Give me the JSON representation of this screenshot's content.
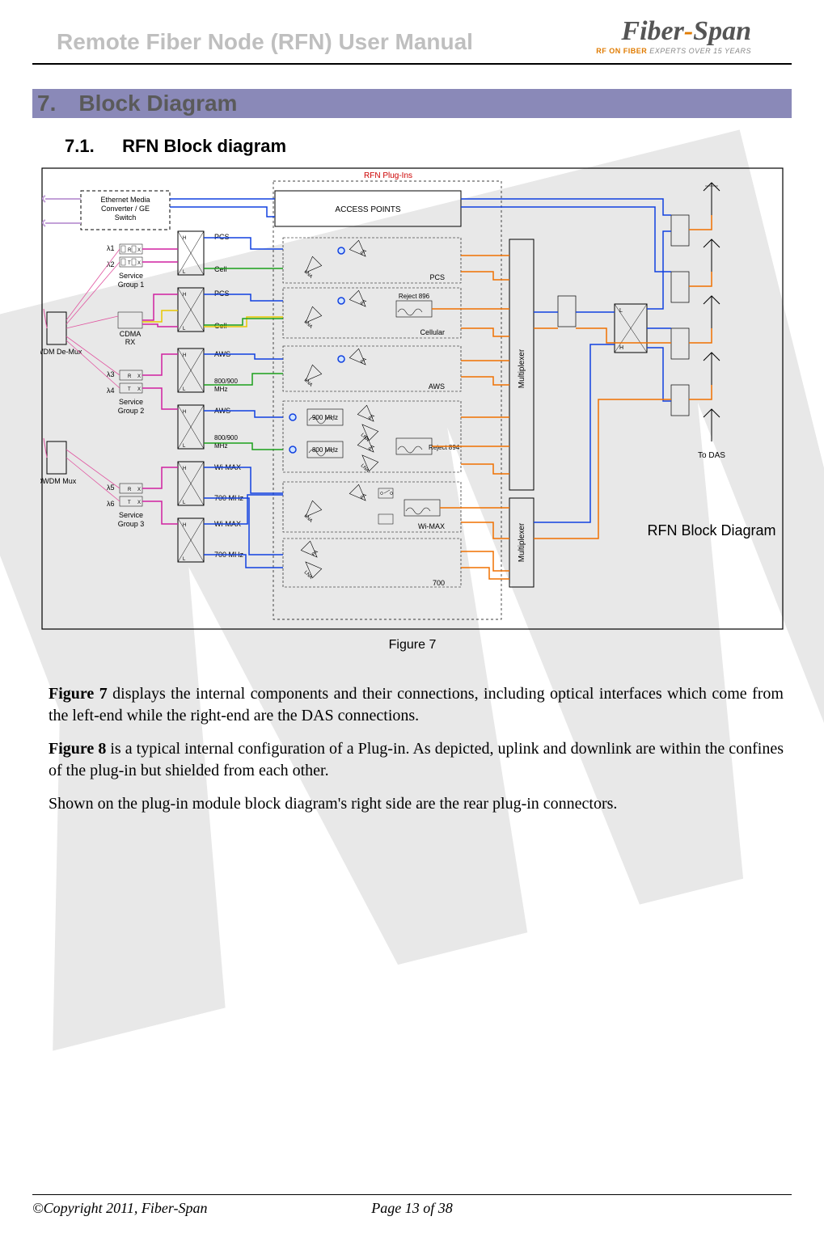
{
  "header": {
    "title": "Remote Fiber Node (RFN) User Manual",
    "logo_main": "Fiber-Span",
    "logo_sub1": "RF ON FIBER",
    "logo_sub2": " EXPERTS OVER 15 YEARS"
  },
  "section": {
    "num": "7.",
    "title": "Block Diagram"
  },
  "subsection": {
    "num": "7.1.",
    "title": "RFN Block diagram"
  },
  "diagram": {
    "top_label": "RFN Plug-Ins",
    "access_points": "ACCESS POINTS",
    "ethernet": "Ethernet Media Converter / GE Switch",
    "dwdm_demux": "DWDM De-Mux",
    "dwdm_mux": "DWDM Mux",
    "sg1": "Service Group 1",
    "sg2": "Service Group 2",
    "sg3": "Service Group 3",
    "cdma_rx": "CDMA RX",
    "lambda1": "λ1",
    "lambda2": "λ2",
    "lambda3": "λ3",
    "lambda4": "λ4",
    "lambda5": "λ5",
    "lambda6": "λ6",
    "label_pcs": "PCS",
    "label_cell": "Cell",
    "label_aws": "AWS",
    "label_800_900": "800/900 MHz",
    "label_wimax": "Wi-MAX",
    "label_700mhz": "700 MHz",
    "label_reject896": "Reject 896",
    "label_cellular": "Cellular",
    "label_900mhz": "900 MHz",
    "label_800mhz": "800 MHz",
    "label_reject894": "Reject 894",
    "label_wimax2": "Wi-MAX",
    "label_700": "700",
    "label_pcs2": "PCS",
    "label_aws2": "AWS",
    "multiplexer": "Multiplexer",
    "to_das": "To DAS",
    "pa": "PA",
    "lna": "LNA",
    "rfn_title": "RFN Block Diagram",
    "caption": "Figure 7",
    "r": "R",
    "t": "T",
    "x": "X",
    "h": "H",
    "l": "L"
  },
  "paragraphs": {
    "p1_a": "Figure 7",
    "p1_b": " displays the internal components and their connections, including optical interfaces which come from the left-end while the right-end are the DAS connections.",
    "p2_a": "Figure 8",
    "p2_b": " is a typical internal configuration of a Plug-in.  As depicted, uplink and downlink are within the confines of the plug-in but shielded from each other.",
    "p3": "Shown on the plug-in module block diagram's right side are the rear plug-in connectors."
  },
  "footer": {
    "copyright": "©Copyright 2011, Fiber-Span",
    "page": "Page 13 of 38"
  }
}
